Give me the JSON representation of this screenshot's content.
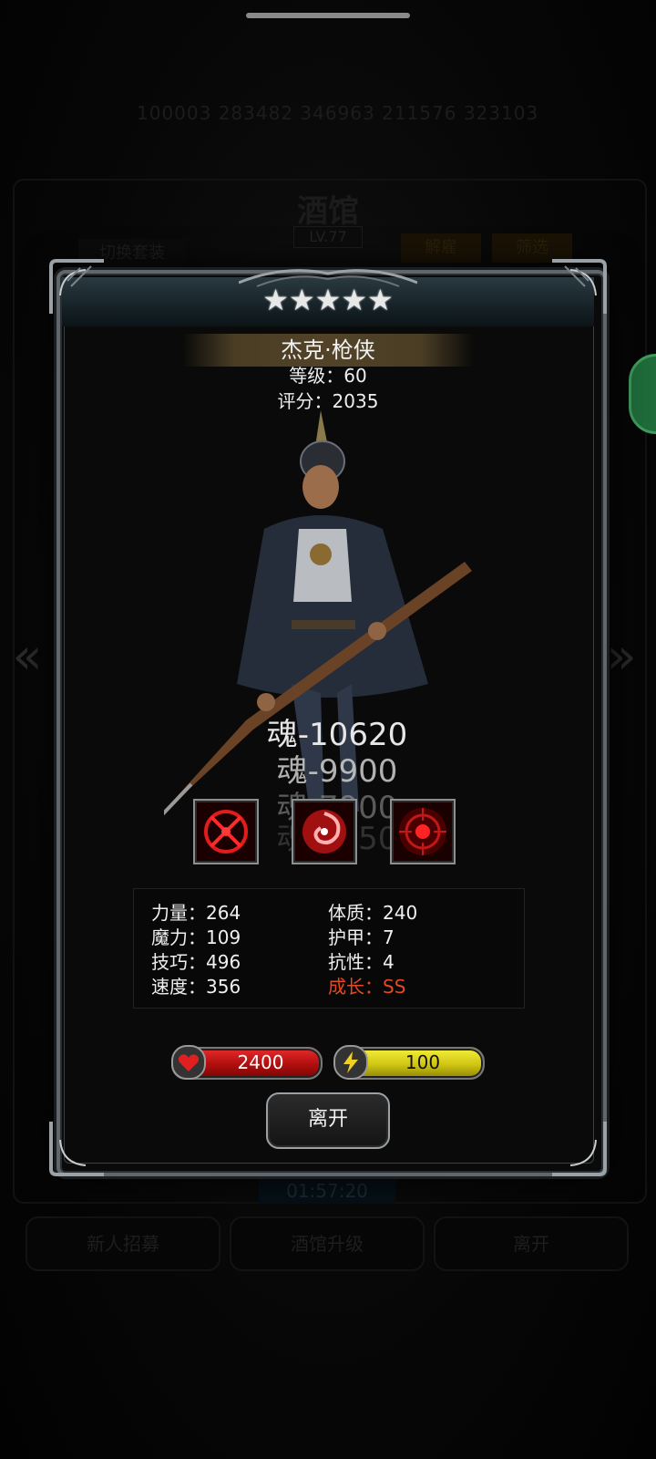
{
  "background": {
    "top_numbers": "100003   283482   346963   211576   323103",
    "title": "酒馆",
    "level": "LV.77",
    "switch_button": "切换套装",
    "sort_button": "解雇",
    "filter_button": "筛选",
    "timer": "01:57:20",
    "bottom_buttons": [
      "新人招募",
      "酒馆升级",
      "离开"
    ]
  },
  "hero": {
    "stars": "★★★★★",
    "name": "杰克·枪侠",
    "level_text": "等级：60",
    "score_text": "评分：2035"
  },
  "floating_souls": [
    "魂-10620",
    "魂-9900",
    "魂-7900",
    "魂-6450"
  ],
  "skills": [
    "crosshair-skill-icon",
    "swirl-skill-icon",
    "target-skill-icon"
  ],
  "stats": {
    "strength": "力量：264",
    "magic": "魔力：109",
    "skill": "技巧：496",
    "speed": "速度：356",
    "constitution": "体质：240",
    "armor": "护甲：7",
    "resistance": "抗性：4",
    "growth": "成长：SS"
  },
  "bars": {
    "hp": "2400",
    "energy": "100"
  },
  "leave_button": "离开",
  "colors": {
    "hp_red": "#c41515",
    "energy_yellow": "#d9cf16",
    "growth_red": "#e34a24",
    "header_blue": "#162228"
  }
}
